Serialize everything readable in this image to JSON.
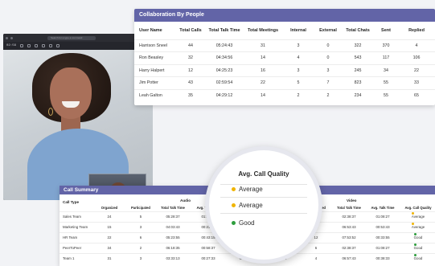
{
  "call_window": {
    "search_placeholder": "Search for a type a command",
    "time": "02:56"
  },
  "collaboration": {
    "title": "Collaboration By People",
    "columns": [
      "User Name",
      "Total Calls",
      "Total Talk Time",
      "Total Meetings",
      "Internal",
      "External",
      "Total Chats",
      "Sent",
      "Replied"
    ],
    "rows": [
      [
        "Harrison Sneel",
        "44",
        "05:24:43",
        "31",
        "3",
        "0",
        "322",
        "370",
        "4"
      ],
      [
        "Ron Beasley",
        "32",
        "04:34:56",
        "14",
        "4",
        "0",
        "543",
        "117",
        "106"
      ],
      [
        "Harry Halpert",
        "12",
        "04:25:23",
        "16",
        "3",
        "3",
        "245",
        "34",
        "22"
      ],
      [
        "Jim Potter",
        "43",
        "02:59:54",
        "22",
        "5",
        "7",
        "823",
        "55",
        "33"
      ],
      [
        "Leah Galton",
        "35",
        "04:29:12",
        "14",
        "2",
        "2",
        "234",
        "55",
        "65"
      ]
    ]
  },
  "summary": {
    "title": "Call Summary",
    "call_type_label": "Call Type",
    "group_audio": "Audio",
    "group_video": "Video",
    "audio_headers": [
      "Organized",
      "Participated",
      "Total Talk Time",
      "Avg. Talk Time",
      "Avg. Call Quality"
    ],
    "video_headers": [
      "Organized",
      "Participated",
      "Total Talk Time",
      "Avg. Talk Time",
      "Avg. Call Quality"
    ],
    "rows": [
      {
        "type": "Sales Team",
        "a": [
          "24",
          "5",
          "05:28:37",
          "01:08:27",
          "Average"
        ],
        "v": [
          "18",
          "6",
          "02:38:37",
          "01:08:27",
          "Average"
        ]
      },
      {
        "type": "Marketing Team",
        "a": [
          "15",
          "3",
          "04:03:43",
          "00:23:53",
          "Average"
        ],
        "v": [
          "12",
          "4",
          "06:53:43",
          "00:53:43",
          "Average"
        ]
      },
      {
        "type": "HR Team",
        "a": [
          "22",
          "6",
          "05:23:55",
          "00:43:15",
          "Average"
        ],
        "v": [
          "12",
          "12",
          "07:53:52",
          "00:33:55",
          "Good"
        ]
      },
      {
        "type": "PeerToPeer",
        "a": [
          "34",
          "2",
          "06:18:35",
          "00:58:37",
          "Good"
        ],
        "v": [
          "34",
          "6",
          "02:38:37",
          "01:08:27",
          "Good"
        ]
      },
      {
        "type": "Team 1",
        "a": [
          "31",
          "3",
          "03:33:13",
          "00:27:33",
          "Good"
        ],
        "v": [
          "12",
          "4",
          "06:57:43",
          "00:38:33",
          "Good"
        ]
      }
    ]
  },
  "quality": {
    "title": "Avg. Call Quality",
    "items": [
      {
        "label": "Average",
        "color": "#f0b400"
      },
      {
        "label": "Average",
        "color": "#f0b400"
      },
      {
        "label": "Good",
        "color": "#2e9e3e"
      }
    ]
  },
  "colors": {
    "accent": "#6264a7",
    "average": "#f0b400",
    "good": "#2e9e3e"
  }
}
